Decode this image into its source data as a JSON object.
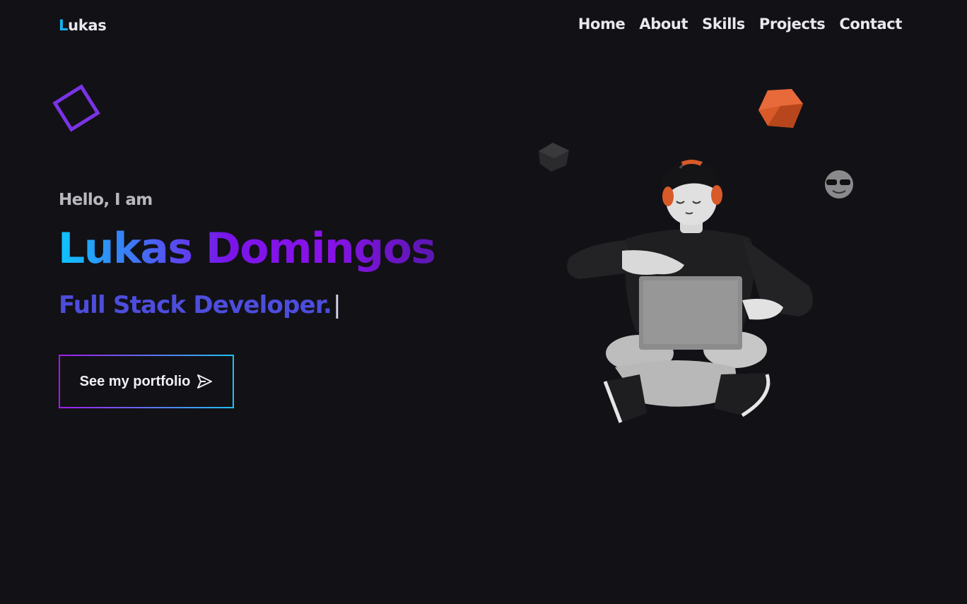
{
  "header": {
    "logo_first": "L",
    "logo_rest": "ukas",
    "nav": [
      {
        "label": "Home"
      },
      {
        "label": "About"
      },
      {
        "label": "Skills"
      },
      {
        "label": "Projects"
      },
      {
        "label": "Contact"
      }
    ]
  },
  "hero": {
    "greeting": "Hello, I am",
    "name": "Lukas Domingos",
    "role": "Full Stack Developer.",
    "caret": "|",
    "cta_label": "See my portfolio"
  },
  "colors": {
    "background": "#121116",
    "accent_cyan": "#13b5f3",
    "accent_purple": "#8a12ea",
    "role_color": "#4d4ddd"
  }
}
